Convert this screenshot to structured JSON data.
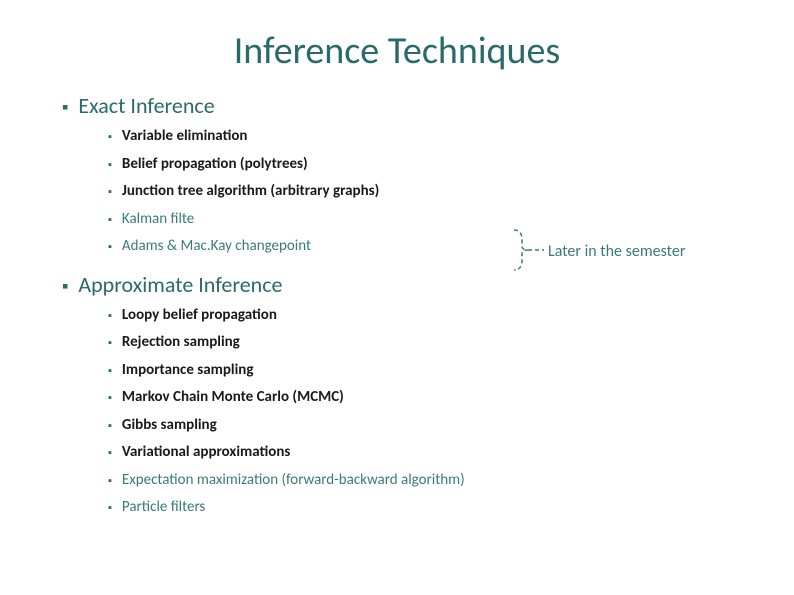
{
  "title": "Inference Techniques",
  "sections": [
    {
      "label": "Exact Inference",
      "items": [
        {
          "text": "Variable elimination",
          "bold": true
        },
        {
          "text": "Belief propagation (polytrees)",
          "bold": true
        },
        {
          "text": "Junction tree algorithm (arbitrary graphs)",
          "bold": true
        },
        {
          "text": "Kalman filte",
          "bold": false
        },
        {
          "text": "Adams & Mac.Kay changepoint",
          "bold": false
        }
      ]
    },
    {
      "label": "Approximate Inference",
      "items": [
        {
          "text": "Loopy belief propagation",
          "bold": true
        },
        {
          "text": "Rejection sampling",
          "bold": true
        },
        {
          "text": "Importance sampling",
          "bold": true
        },
        {
          "text": "Markov Chain Monte Carlo (MCMC)",
          "bold": true
        },
        {
          "text": "Gibbs sampling",
          "bold": true
        },
        {
          "text": "Variational approximations",
          "bold": true
        },
        {
          "text": "Expectation maximization (forward-backward algorithm)",
          "bold": false
        },
        {
          "text": "Particle filters",
          "bold": false
        }
      ]
    }
  ],
  "callout": "Later in the semester",
  "bullet_glyph": "▪"
}
